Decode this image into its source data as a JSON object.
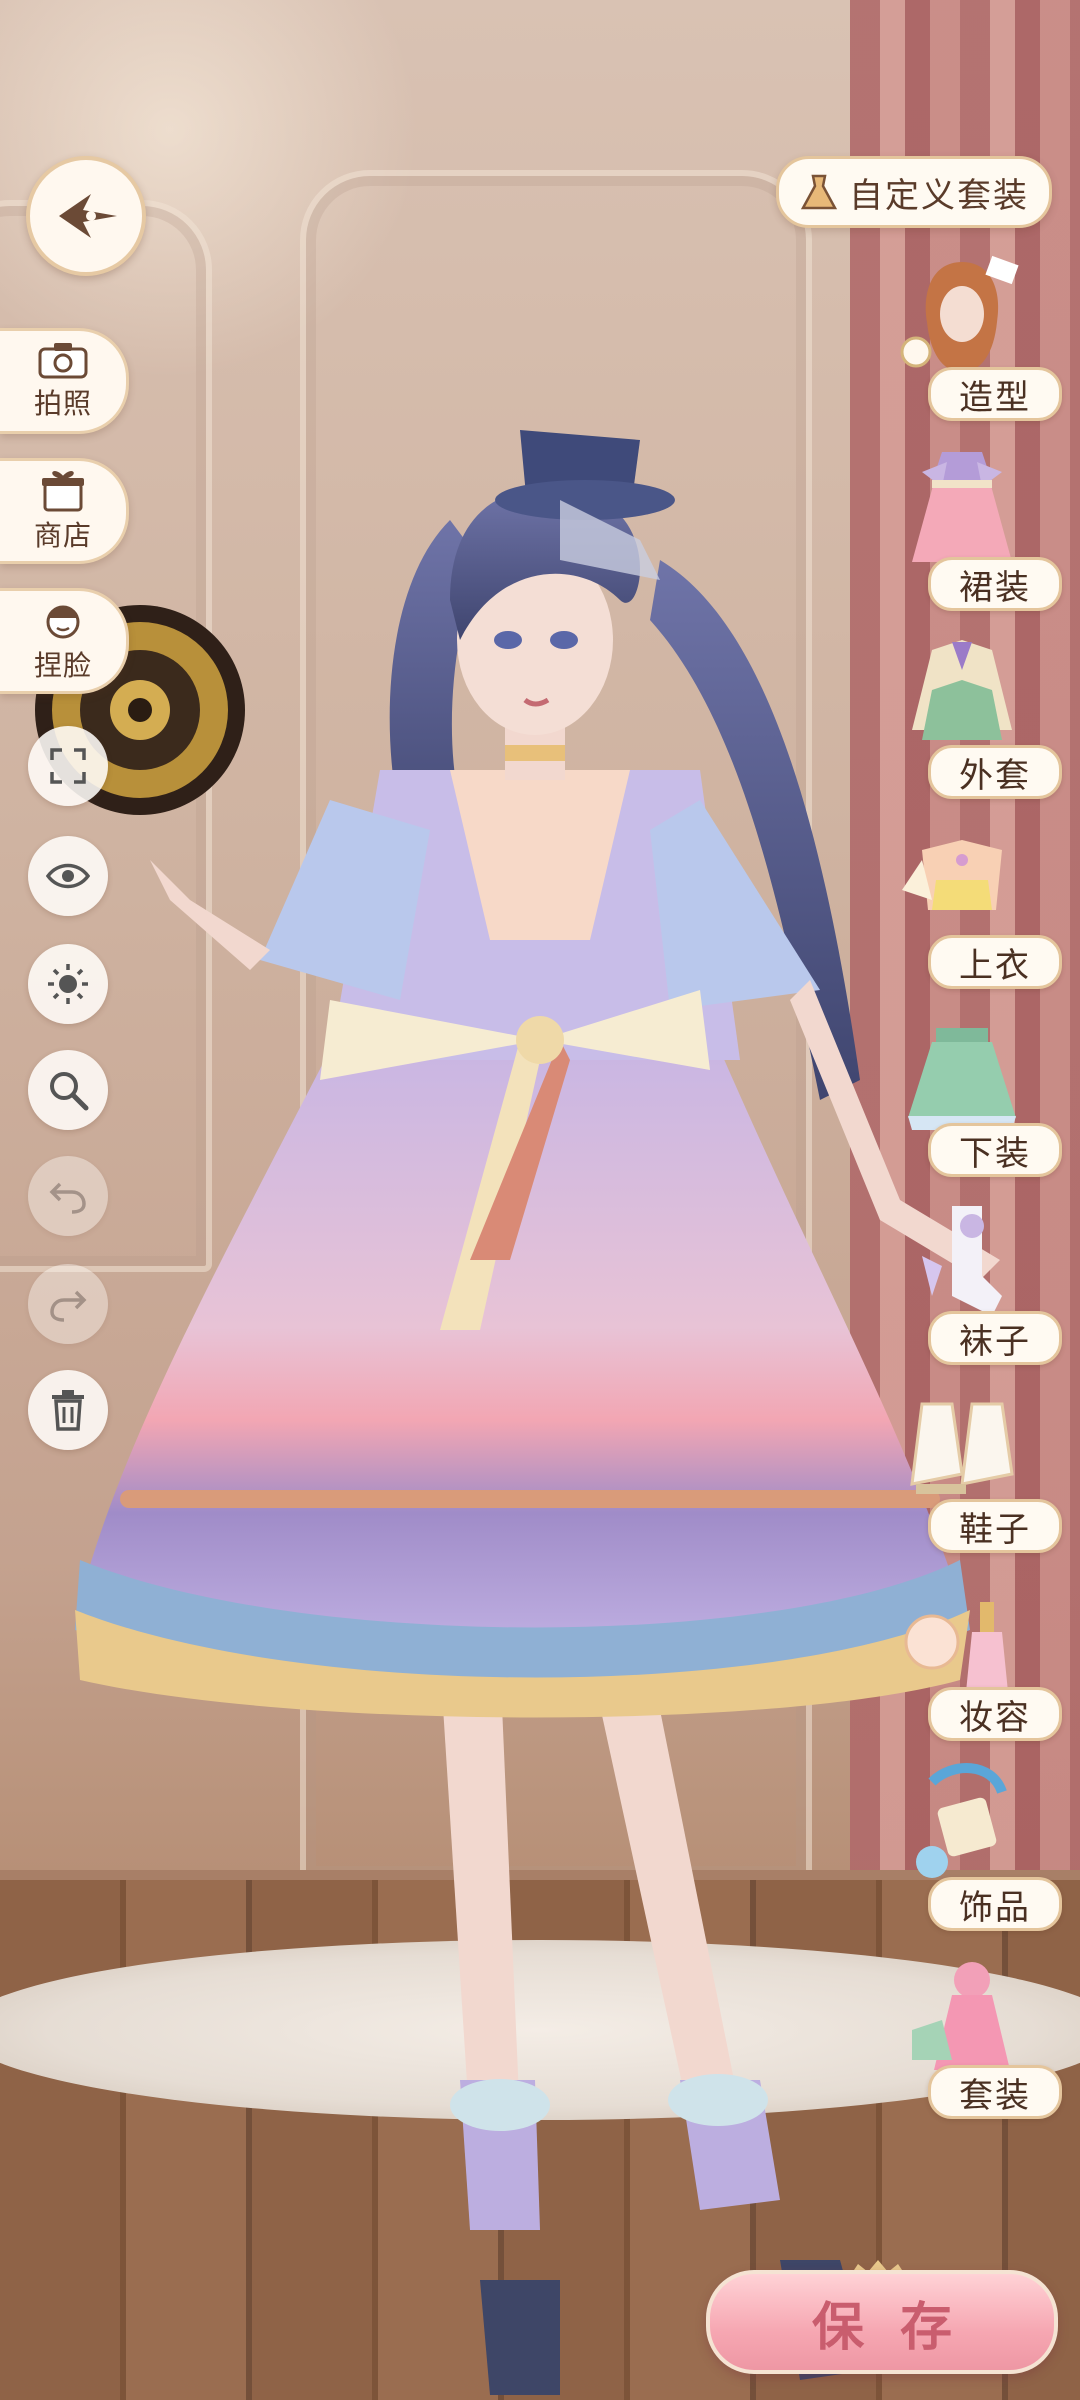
{
  "left_menu": {
    "photo_label": "拍照",
    "shop_label": "商店",
    "face_label": "捏脸"
  },
  "right_menu": {
    "custom_outfit_label": "自定义套装",
    "categories": [
      {
        "label": "造型",
        "icon": "hairstyle-icon"
      },
      {
        "label": "裙装",
        "icon": "dress-icon"
      },
      {
        "label": "外套",
        "icon": "coat-icon"
      },
      {
        "label": "上衣",
        "icon": "top-icon"
      },
      {
        "label": "下装",
        "icon": "skirt-icon"
      },
      {
        "label": "袜子",
        "icon": "socks-icon"
      },
      {
        "label": "鞋子",
        "icon": "shoes-icon"
      },
      {
        "label": "妆容",
        "icon": "makeup-icon"
      },
      {
        "label": "饰品",
        "icon": "accessory-icon"
      },
      {
        "label": "套装",
        "icon": "outfit-set-icon"
      }
    ]
  },
  "save_label": "保存",
  "tools": [
    "fullscreen-icon",
    "eye-icon",
    "sun-icon",
    "zoom-icon",
    "undo-icon",
    "redo-icon",
    "trash-icon"
  ],
  "colors": {
    "pill_bg": "#fffaf2",
    "pill_border": "#e4c59c",
    "text_brown": "#4a3022",
    "save_pink": "#f6a7b2"
  }
}
